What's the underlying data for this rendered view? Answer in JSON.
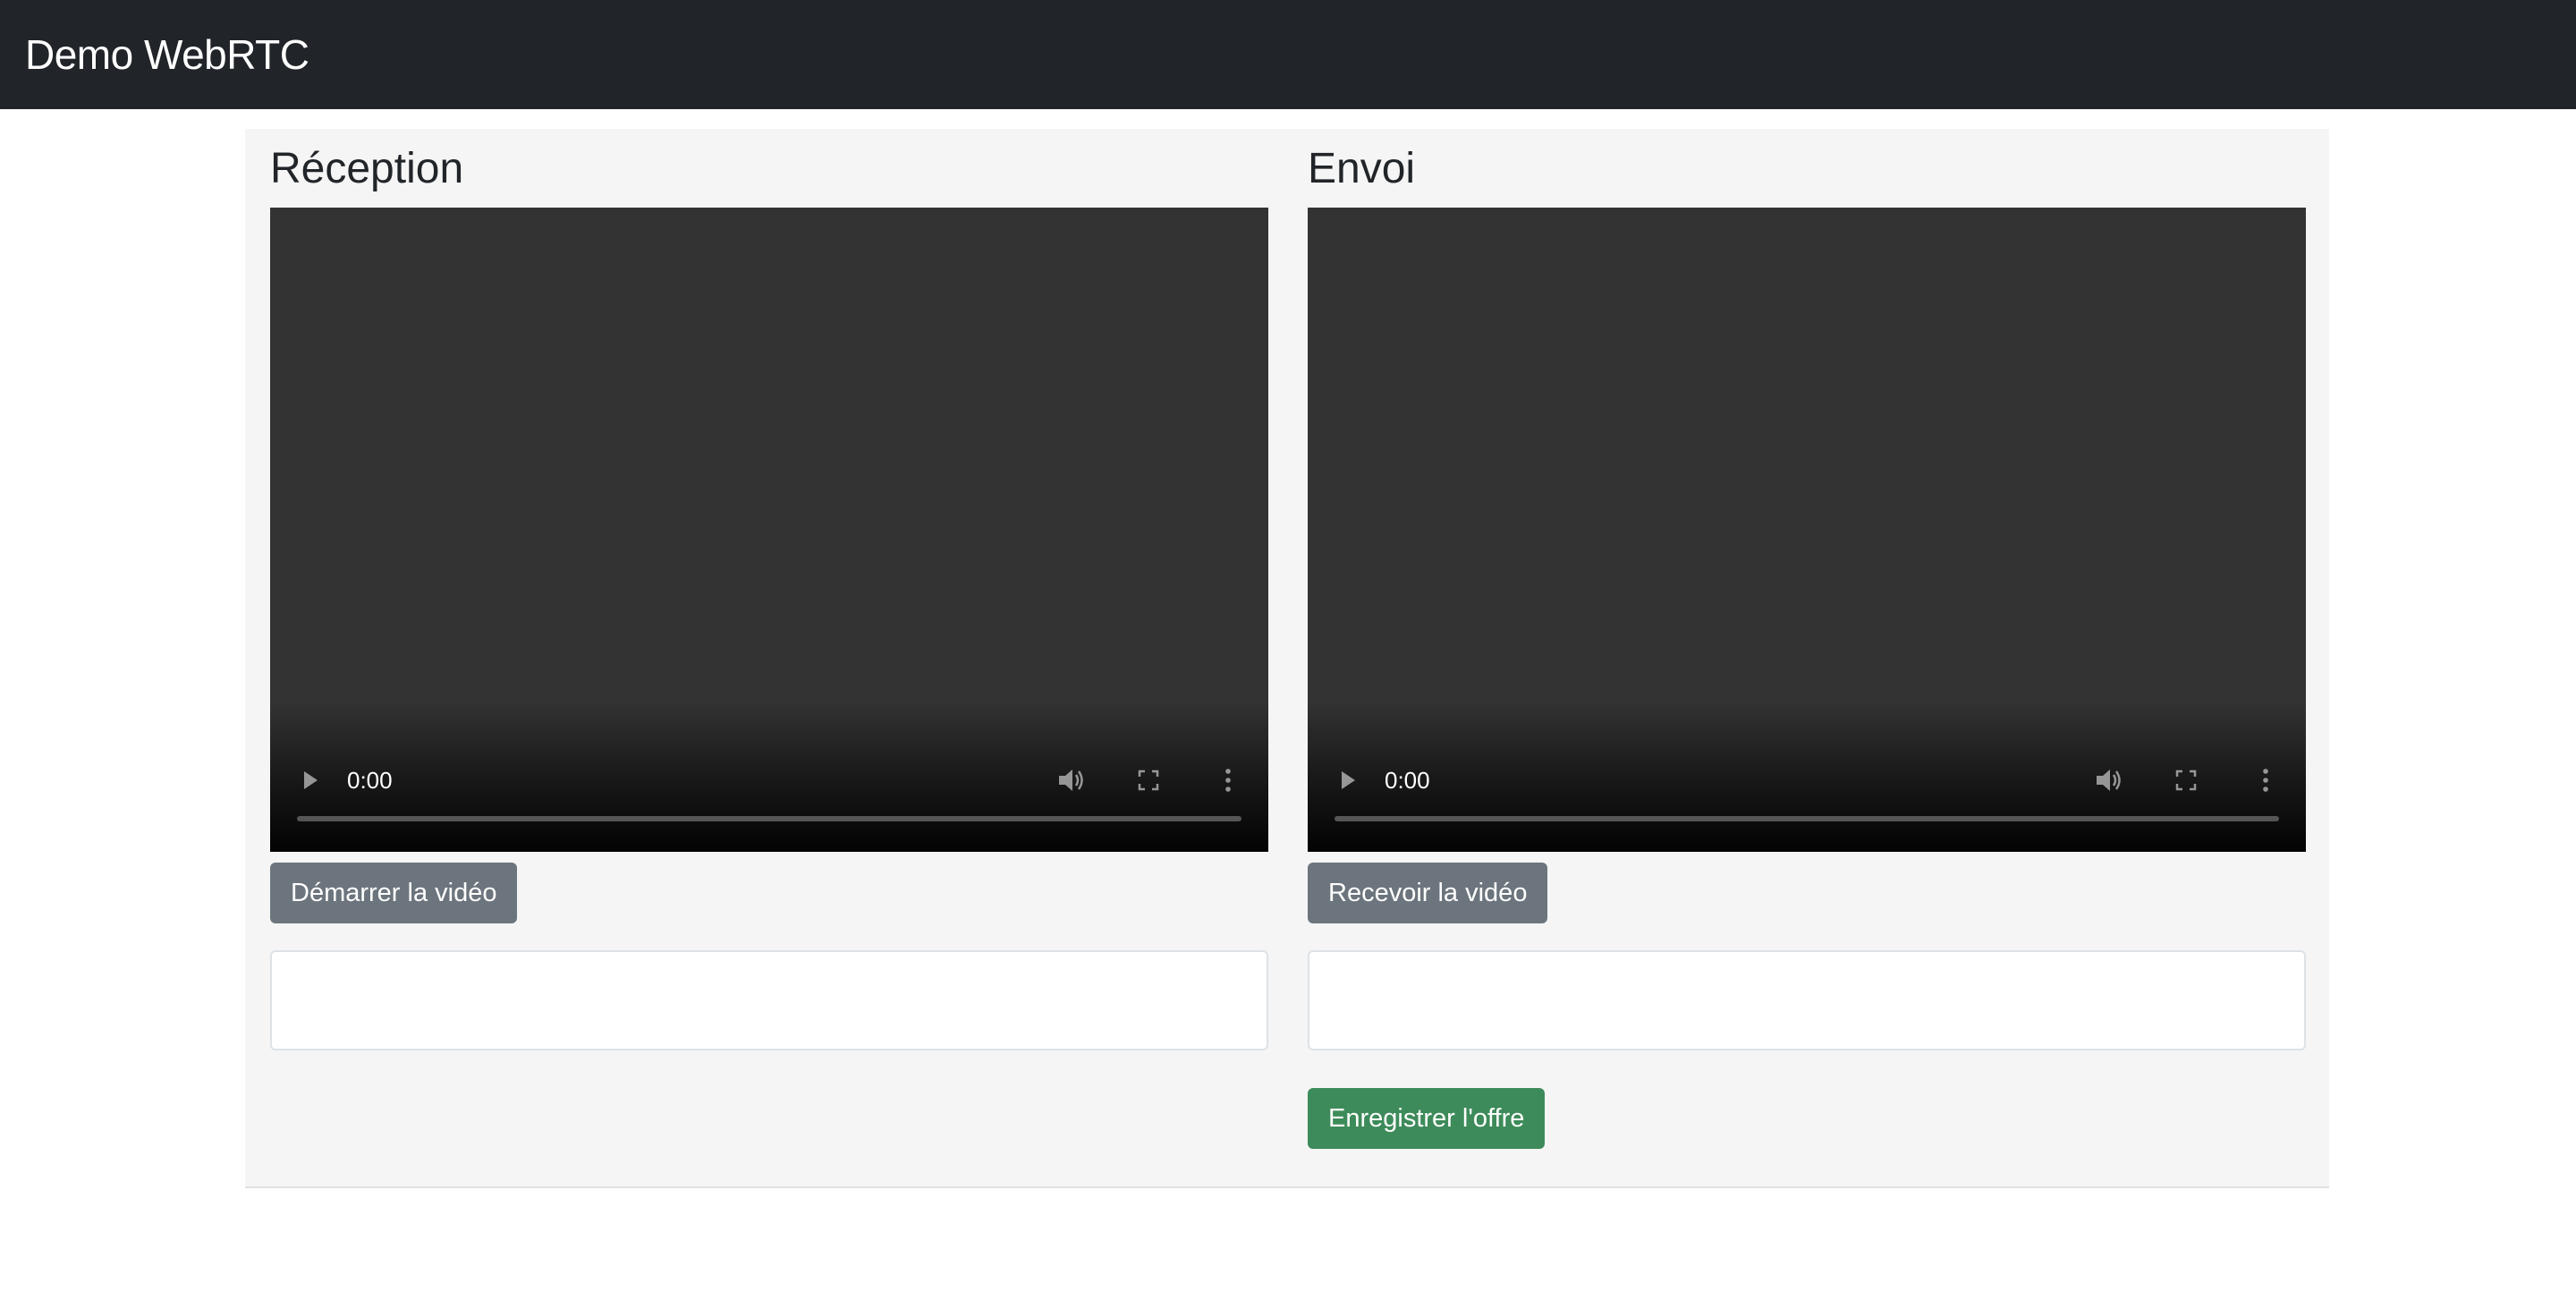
{
  "navbar": {
    "brand": "Demo WebRTC"
  },
  "left": {
    "title": "Réception",
    "video": {
      "time": "0:00",
      "progress": 0
    },
    "button_label": "Démarrer la vidéo",
    "textarea_value": ""
  },
  "right": {
    "title": "Envoi",
    "video": {
      "time": "0:00",
      "progress": 0
    },
    "button_label": "Recevoir la vidéo",
    "textarea_value": "",
    "save_button_label": "Enregistrer l'offre"
  },
  "icons": {
    "play": "play-icon",
    "volume": "volume-icon",
    "fullscreen": "fullscreen-icon",
    "more": "more-vert-icon"
  },
  "colors": {
    "navbar": "#212529",
    "panel": "#f5f5f5",
    "video_background": "#333333",
    "button_secondary": "#6c757d",
    "button_success": "#3d8b5a"
  }
}
